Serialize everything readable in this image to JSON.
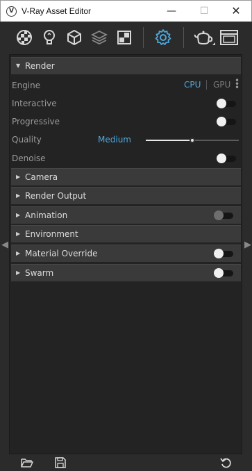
{
  "window": {
    "title": "V-Ray Asset Editor",
    "logo_letter": "V",
    "minimize_glyph": "—",
    "maximize_glyph": "☐",
    "close_glyph": "✕"
  },
  "toolbar": {
    "icons": [
      "materials-icon",
      "lights-icon",
      "geometry-icon",
      "layers-icon",
      "textures-icon",
      "settings-icon",
      "render-teapot-icon",
      "frame-buffer-icon"
    ],
    "active": "settings-icon",
    "accent": "#4ea8de"
  },
  "render": {
    "label": "Render",
    "expanded": true,
    "engine": {
      "label": "Engine",
      "cpu": "CPU",
      "gpu": "GPU",
      "selected": "CPU"
    },
    "interactive": {
      "label": "Interactive",
      "on": false
    },
    "progressive": {
      "label": "Progressive",
      "on": false
    },
    "quality": {
      "label": "Quality",
      "value": "Medium",
      "level": 0.5
    },
    "denoise": {
      "label": "Denoise",
      "on": false
    }
  },
  "sections": [
    {
      "label": "Camera",
      "has_toggle": false
    },
    {
      "label": "Render Output",
      "has_toggle": false
    },
    {
      "label": "Animation",
      "has_toggle": true,
      "on": false,
      "dim": true
    },
    {
      "label": "Environment",
      "has_toggle": false
    },
    {
      "label": "Material Override",
      "has_toggle": true,
      "on": false,
      "dim": false
    },
    {
      "label": "Swarm",
      "has_toggle": true,
      "on": false,
      "dim": false
    }
  ],
  "statusbar": {
    "icons": [
      "open-folder-icon",
      "save-icon",
      "reset-icon"
    ]
  }
}
